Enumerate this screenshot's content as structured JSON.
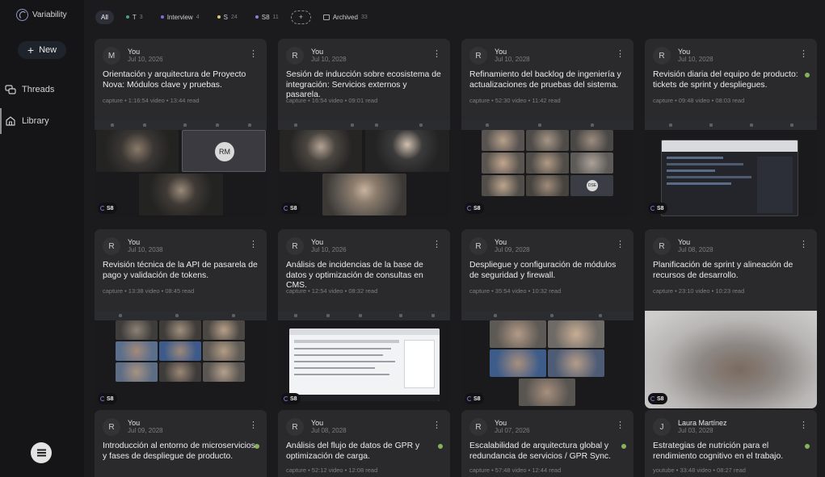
{
  "app": {
    "name": "Variability",
    "new_label": "New"
  },
  "nav": {
    "items": [
      {
        "label": "Threads",
        "icon": "threads-icon"
      },
      {
        "label": "Library",
        "icon": "library-icon"
      }
    ]
  },
  "filters": {
    "all_label": "All",
    "chips": [
      {
        "label": "T",
        "count": "3",
        "color": "#4f9c86"
      },
      {
        "label": "Interview",
        "count": "4",
        "color": "#7c6fd6"
      },
      {
        "label": "S",
        "count": "24",
        "color": "#e5c76b"
      },
      {
        "label": "S8",
        "count": "11",
        "color": "#8e7fe0"
      }
    ],
    "add_label": "+",
    "archived_label": "Archived",
    "archived_count": "33"
  },
  "cards": [
    {
      "avatar": "M",
      "user": "You",
      "date": "Jul 10, 2026",
      "title": "Orientación y arquitectura de Proyecto Nova: Módulos clave y pruebas.",
      "meta": "capture • 1:16:54 video • 13:44 read",
      "status": false,
      "badge": "S8",
      "thumb_label": "RM"
    },
    {
      "avatar": "R",
      "user": "You",
      "date": "Jul 10, 2028",
      "title": "Sesión de inducción sobre ecosistema de integración: Servicios externos y pasarela.",
      "meta": "capture • 16:54 video • 09:01 read",
      "status": false,
      "badge": "S8"
    },
    {
      "avatar": "R",
      "user": "You",
      "date": "Jul 10, 2028",
      "title": "Refinamiento del backlog de ingeniería y actualizaciones de pruebas del sistema.",
      "meta": "capture • 52:30 video • 11:42 read",
      "status": false,
      "badge": "S8",
      "thumb_label": "DSE"
    },
    {
      "avatar": "R",
      "user": "You",
      "date": "Jul 10, 2028",
      "title": "Revisión diaria del equipo de producto: tickets de sprint y despliegues.",
      "meta": "capture • 09:48 video • 08:03 read",
      "status": true,
      "badge": "S8"
    },
    {
      "avatar": "R",
      "user": "You",
      "date": "Jul 10, 2038",
      "title": "Revisión técnica de la API de pasarela de pago y validación de tokens.",
      "meta": "capture • 13:38 video • 08:45 read",
      "status": false,
      "badge": "S8"
    },
    {
      "avatar": "R",
      "user": "You",
      "date": "Jul 10, 2026",
      "title": "Análisis de incidencias de la base de datos y optimización de consultas en CMS.",
      "meta": "capture • 12:54 video • 08:32 read",
      "status": false,
      "badge": "S8"
    },
    {
      "avatar": "R",
      "user": "You",
      "date": "Jul 09, 2028",
      "title": "Despliegue y configuración de módulos de seguridad y firewall.",
      "meta": "capture • 35:54 video • 10:32 read",
      "status": false,
      "badge": "S8"
    },
    {
      "avatar": "R",
      "user": "You",
      "date": "Jul 08, 2028",
      "title": "Planificación de sprint y alineación de recursos de desarrollo.",
      "meta": "capture • 23:10 video • 10:23 read",
      "status": false,
      "badge": "S8"
    },
    {
      "avatar": "R",
      "user": "You",
      "date": "Jul 09, 2028",
      "title": "Introducción al entorno de microservicios y fases de despliegue de producto.",
      "meta": "",
      "status": true
    },
    {
      "avatar": "R",
      "user": "You",
      "date": "Jul 08, 2028",
      "title": "Análisis del flujo de datos de GPR y optimización de carga.",
      "meta": "capture • 52:12 video • 12:08 read",
      "status": true
    },
    {
      "avatar": "R",
      "user": "You",
      "date": "Jul 07, 2026",
      "title": "Escalabilidad de arquitectura global y redundancia de servicios / GPR Sync.",
      "meta": "capture • 57:48 video • 12:44 read",
      "status": true
    },
    {
      "avatar": "J",
      "user": "Laura Martínez",
      "date": "Jul 03, 2028",
      "title": "Estrategias de nutrición para el rendimiento cognitivo en el trabajo.",
      "meta": "youtube • 33:48 video • 08:27 read",
      "status": true
    }
  ]
}
